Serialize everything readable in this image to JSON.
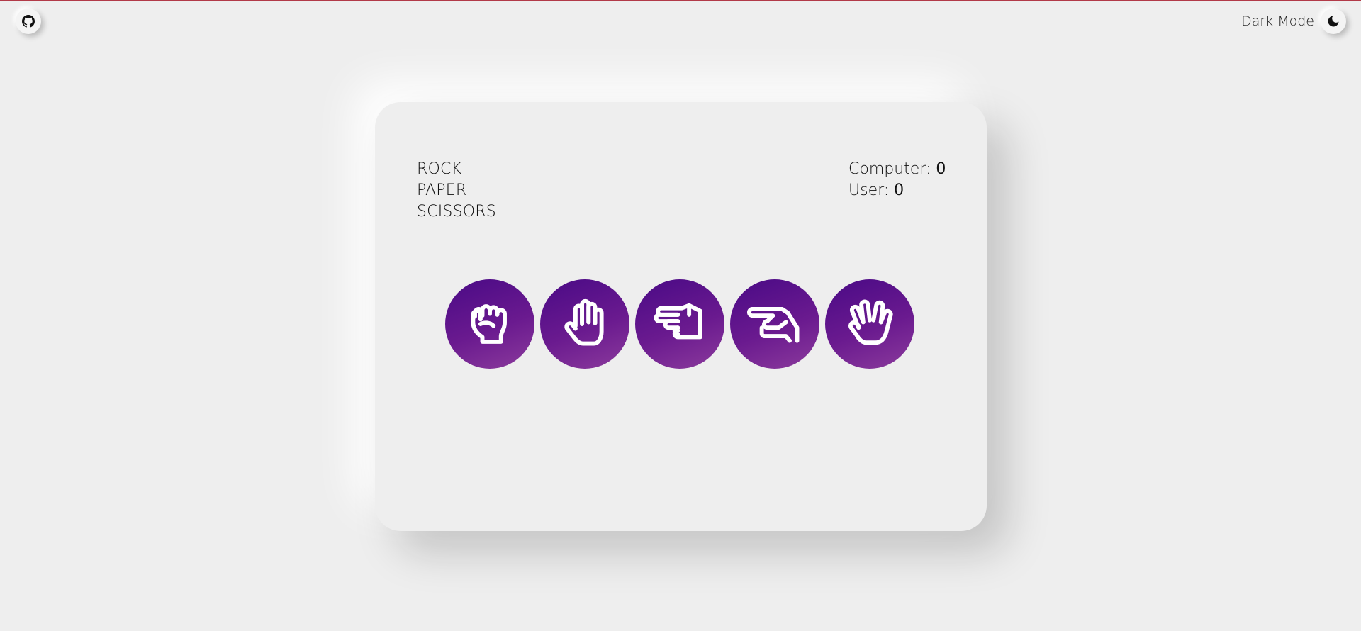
{
  "header": {
    "dark_mode_label": "Dark Mode",
    "github_icon": "github-icon",
    "theme_icon": "moon-icon"
  },
  "game": {
    "title_lines": [
      "ROCK",
      "PAPER",
      "SCISSORS"
    ],
    "scores": {
      "computer_label": "Computer:",
      "computer_value": "0",
      "user_label": "User:",
      "user_value": "0"
    },
    "choices": [
      {
        "icon": "rock-hand-icon"
      },
      {
        "icon": "paper-hand-icon"
      },
      {
        "icon": "scissors-hand-icon"
      },
      {
        "icon": "lizard-hand-icon"
      },
      {
        "icon": "spock-hand-icon"
      }
    ]
  },
  "colors": {
    "background": "#eeeeee",
    "accent_purple": "#4a0a86",
    "accent_purple_light": "#8b3a9c"
  }
}
